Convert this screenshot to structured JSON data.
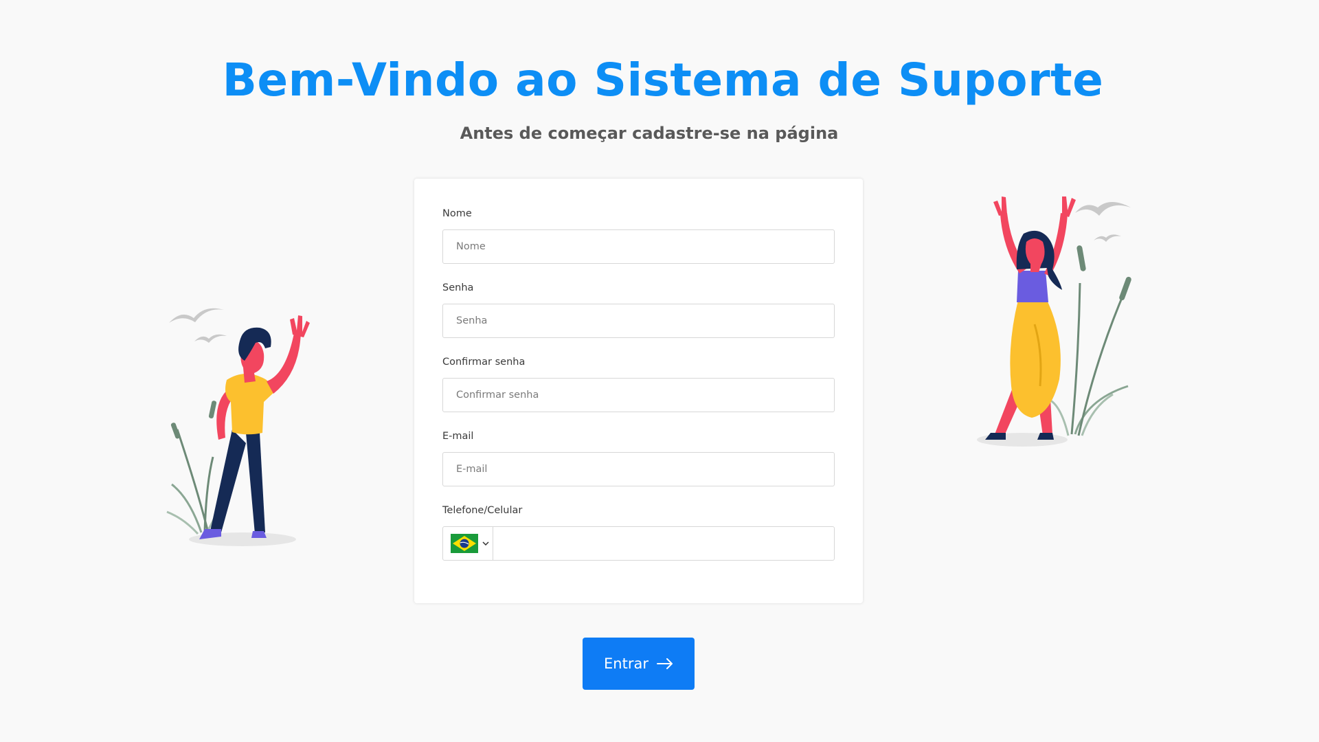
{
  "header": {
    "title": "Bem-Vindo ao Sistema de Suporte",
    "subtitle": "Antes de começar cadastre-se na página"
  },
  "form": {
    "fields": [
      {
        "label": "Nome",
        "placeholder": "Nome",
        "value": ""
      },
      {
        "label": "Senha",
        "placeholder": "Senha",
        "value": ""
      },
      {
        "label": "Confirmar senha",
        "placeholder": "Confirmar senha",
        "value": ""
      },
      {
        "label": "E-mail",
        "placeholder": "E-mail",
        "value": ""
      }
    ],
    "phone": {
      "label": "Telefone/Celular",
      "country_icon": "brazil-flag-icon",
      "value": ""
    }
  },
  "submit": {
    "label": "Entrar",
    "icon": "arrow-right-icon"
  },
  "colors": {
    "title": "#0d8ef5",
    "button": "#0e7cf5",
    "background": "#f9f9f9"
  }
}
